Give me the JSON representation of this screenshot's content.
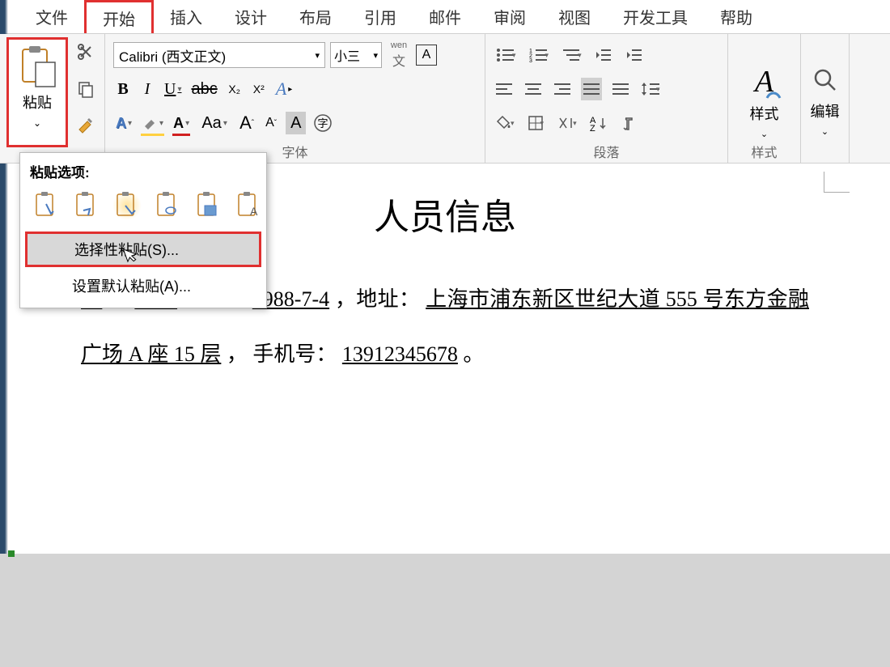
{
  "tabs": {
    "file": "文件",
    "home": "开始",
    "insert": "插入",
    "design": "设计",
    "layout": "布局",
    "references": "引用",
    "mail": "邮件",
    "review": "审阅",
    "view": "视图",
    "developer": "开发工具",
    "help": "帮助"
  },
  "ribbon": {
    "paste": {
      "label": "粘贴",
      "menu_title": "粘贴选项:",
      "special_paste": "选择性粘贴(S)...",
      "default_paste": "设置默认粘贴(A)..."
    },
    "font": {
      "name": "Calibri (西文正文)",
      "size": "小三",
      "group_label": "字体",
      "wen": "wen",
      "wen2": "文",
      "A": "A",
      "B": "B",
      "I": "I",
      "U": "U",
      "abc": "abc",
      "x2": "X₂",
      "x2sup": "X²",
      "Aa": "Aa",
      "Abig": "A",
      "Asmall": "A"
    },
    "paragraph": {
      "group_label": "段落"
    },
    "styles": {
      "icon": "A",
      "label": "样式",
      "group_label": "样式"
    },
    "edit": {
      "label": "编辑"
    }
  },
  "document": {
    "title": "人员信息",
    "body_prefix": "男",
    "comma1": "，",
    "ethnicity": "汉族",
    "born_prefix": "，生于 ",
    "dob": "1988-7-4",
    "addr_prefix": "，地址：",
    "address": "上海市浦东新区世纪大道 555 号东方金融广场 A 座 15 层",
    "phone_prefix": "， 手机号：",
    "phone": "13912345678",
    "period": " 。"
  }
}
